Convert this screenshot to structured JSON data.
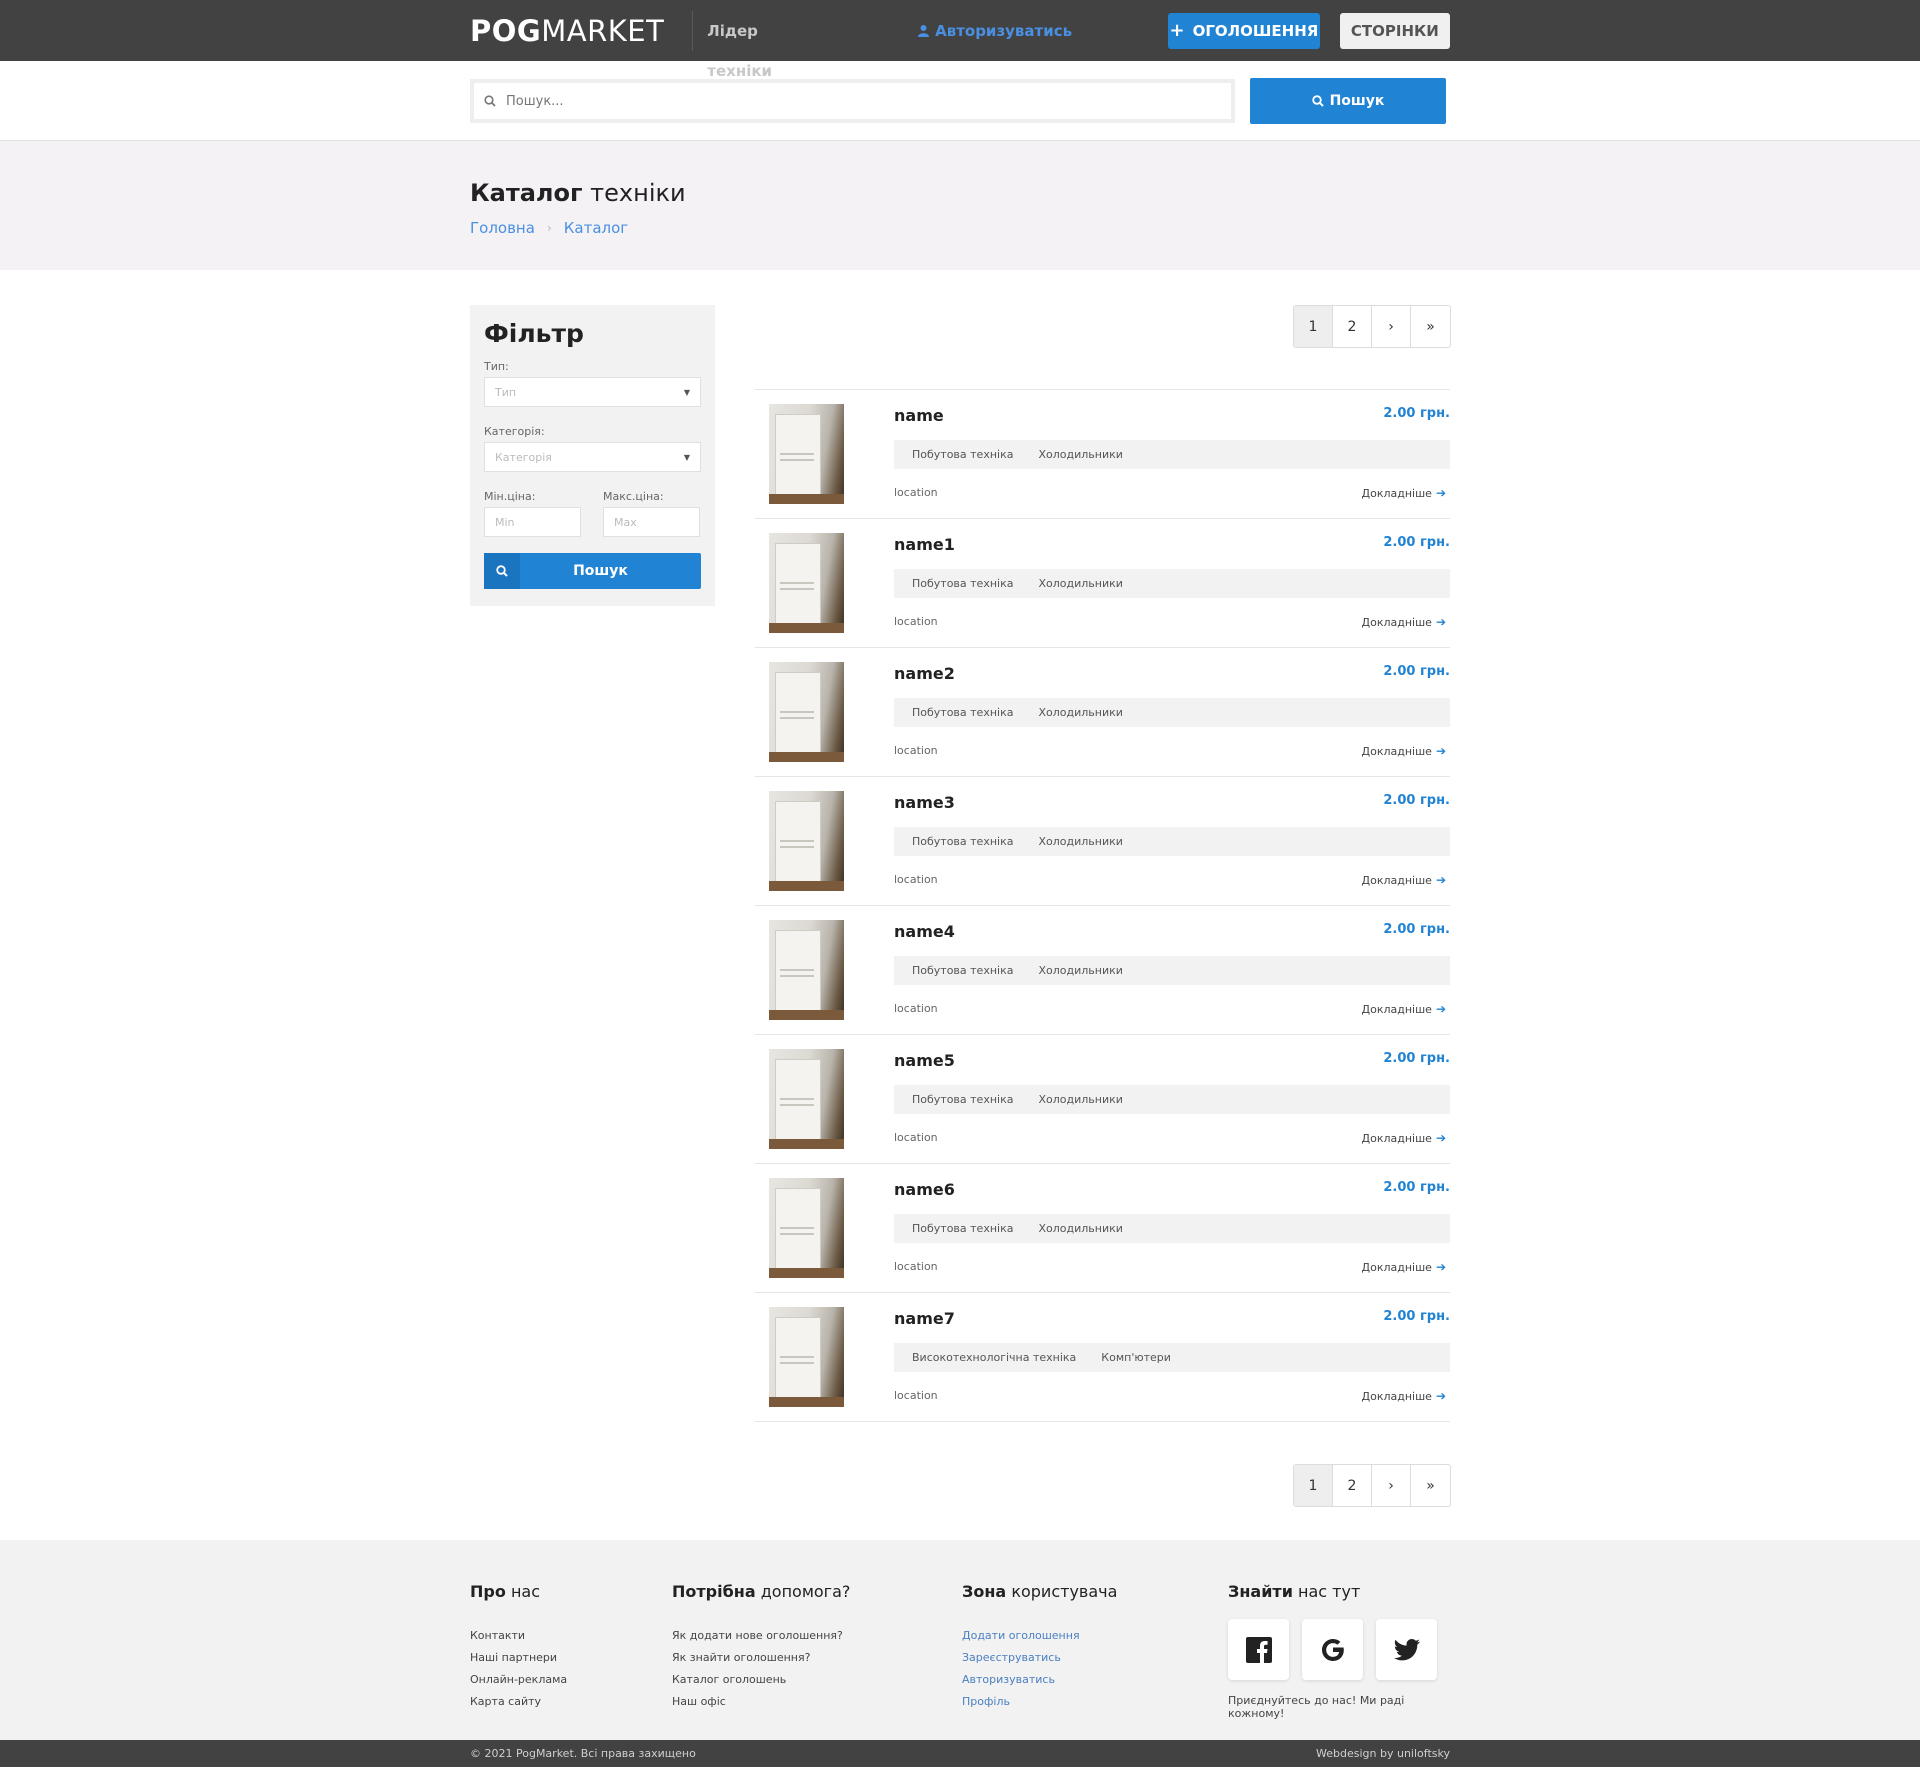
{
  "header": {
    "logo_bold": "POG",
    "logo_light": "MARKET",
    "tagline": "Лідер техніки",
    "auth_link": "Авторизуватись",
    "add_button": "ОГОЛОШЕННЯ",
    "pages_button": "СТОРІНКИ"
  },
  "search": {
    "placeholder": "Пошук...",
    "button": "Пошук"
  },
  "title": {
    "bold": "Каталог",
    "light": "техніки",
    "breadcrumb": [
      "Головна",
      "Каталог"
    ]
  },
  "filter": {
    "heading": "Фільтр",
    "type_label": "Тип:",
    "type_placeholder": "Тип",
    "category_label": "Категорія:",
    "category_placeholder": "Категорія",
    "min_label": "Мін.ціна:",
    "min_placeholder": "Min",
    "max_label": "Макс.ціна:",
    "max_placeholder": "Max",
    "button": "Пошук"
  },
  "pagination": [
    "1",
    "2",
    "›",
    "»"
  ],
  "items": [
    {
      "name": "name",
      "price": "2.00 грн.",
      "tag1": "Побутова техніка",
      "tag2": "Холодильники",
      "location": "location",
      "more": "Докладніше"
    },
    {
      "name": "name1",
      "price": "2.00 грн.",
      "tag1": "Побутова техніка",
      "tag2": "Холодильники",
      "location": "location",
      "more": "Докладніше"
    },
    {
      "name": "name2",
      "price": "2.00 грн.",
      "tag1": "Побутова техніка",
      "tag2": "Холодильники",
      "location": "location",
      "more": "Докладніше"
    },
    {
      "name": "name3",
      "price": "2.00 грн.",
      "tag1": "Побутова техніка",
      "tag2": "Холодильники",
      "location": "location",
      "more": "Докладніше"
    },
    {
      "name": "name4",
      "price": "2.00 грн.",
      "tag1": "Побутова техніка",
      "tag2": "Холодильники",
      "location": "location",
      "more": "Докладніше"
    },
    {
      "name": "name5",
      "price": "2.00 грн.",
      "tag1": "Побутова техніка",
      "tag2": "Холодильники",
      "location": "location",
      "more": "Докладніше"
    },
    {
      "name": "name6",
      "price": "2.00 грн.",
      "tag1": "Побутова техніка",
      "tag2": "Холодильники",
      "location": "location",
      "more": "Докладніше"
    },
    {
      "name": "name7",
      "price": "2.00 грн.",
      "tag1": "Високотехнологічна техніка",
      "tag2": "Комп'ютери",
      "location": "location",
      "more": "Докладніше"
    }
  ],
  "footer": {
    "about": {
      "bold": "Про",
      "light": "нас",
      "links": [
        "Контакти",
        "Наші партнери",
        "Онлайн-реклама",
        "Карта сайту"
      ]
    },
    "help": {
      "bold": "Потрібна",
      "light": "допомога?",
      "links": [
        "Як додати нове оголошення?",
        "Як знайти оголошення?",
        "Каталог оголошень",
        "Наш офіс"
      ]
    },
    "user": {
      "bold": "Зона",
      "light": "користувача",
      "links": [
        "Додати оголошення",
        "Зареєструватись",
        "Авторизуватись",
        "Профіль"
      ]
    },
    "social": {
      "bold": "Знайти",
      "light": "нас тут",
      "note": "Приєднуйтесь до нас! Ми раді кожному!"
    },
    "copyright": "© 2021 PogMarket. Всі права захищено",
    "credit": "Webdesign by uniloftsky"
  },
  "colors": {
    "accent": "#2183d4",
    "topbar": "#424242",
    "link": "#4a90e2"
  }
}
